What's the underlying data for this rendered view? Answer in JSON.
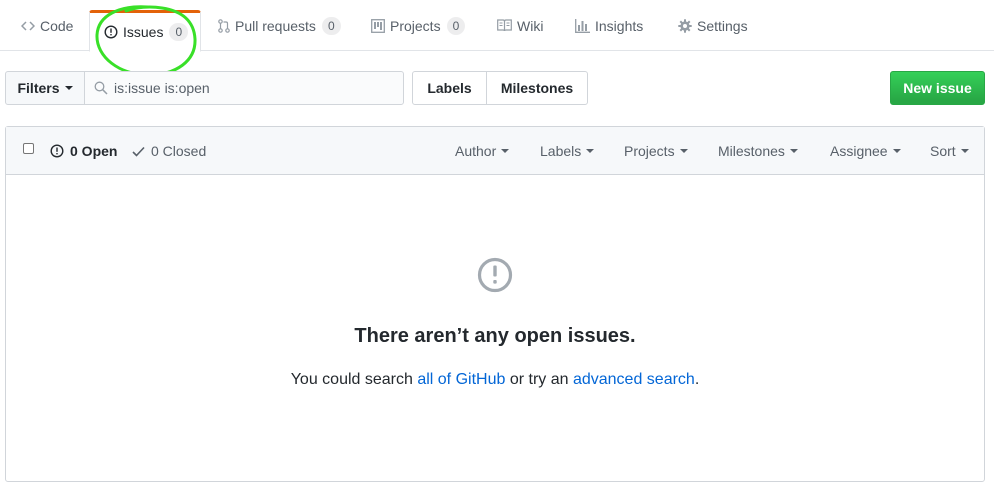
{
  "nav": {
    "tabs": [
      {
        "label": "Code",
        "icon": "code-icon"
      },
      {
        "label": "Issues",
        "icon": "issue-opened-icon",
        "count": "0",
        "selected": true
      },
      {
        "label": "Pull requests",
        "icon": "git-pull-request-icon",
        "count": "0"
      },
      {
        "label": "Projects",
        "icon": "project-icon",
        "count": "0"
      },
      {
        "label": "Wiki",
        "icon": "book-icon"
      },
      {
        "label": "Insights",
        "icon": "graph-icon"
      },
      {
        "label": "Settings",
        "icon": "gear-icon"
      }
    ]
  },
  "filters": {
    "button_label": "Filters",
    "search_value": "is:issue is:open",
    "labels_label": "Labels",
    "milestones_label": "Milestones",
    "new_issue_label": "New issue"
  },
  "list_header": {
    "open_label": "0 Open",
    "closed_label": "0 Closed",
    "dropdowns": [
      "Author",
      "Labels",
      "Projects",
      "Milestones",
      "Assignee",
      "Sort"
    ]
  },
  "blankslate": {
    "title": "There aren’t any open issues.",
    "text_before": "You could search ",
    "link_all": "all of GitHub",
    "text_middle": " or try an ",
    "link_advanced": "advanced search",
    "text_after": "."
  },
  "colors": {
    "accent_tab": "#e36209",
    "annotation_circle": "#39e028",
    "new_issue_green": "#2cbe4e",
    "link_blue": "#0366d6"
  }
}
